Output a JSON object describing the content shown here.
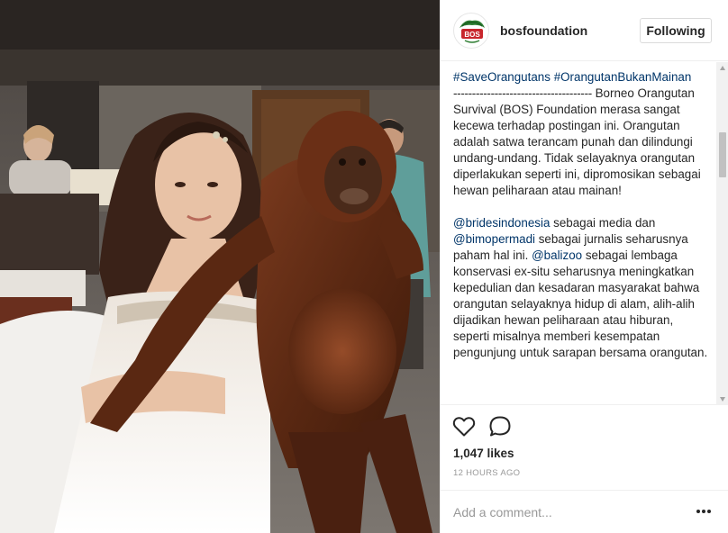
{
  "post": {
    "username": "bosfoundation",
    "follow_label": "Following",
    "logo_text": "BOS",
    "caption": {
      "hashtag1": "#SaveOrangutans",
      "hashtag2": "#OrangutanBukanMainan",
      "dashes": "-------------------------------------",
      "para1": " Borneo Orangutan Survival (BOS) Foundation merasa sangat kecewa terhadap postingan ini. Orangutan adalah satwa terancam punah dan dilindungi undang-undang. Tidak selayaknya orangutan diperlakukan seperti ini, dipromosikan sebagai hewan peliharaan atau mainan!",
      "mention1": "@bridesindonesia",
      "text2": " sebagai media dan ",
      "mention2": "@bimopermadi",
      "text3": " sebagai jurnalis seharusnya paham hal ini. ",
      "mention3": "@balizoo",
      "text4": " sebagai lembaga konservasi ex-situ seharusnya meningkatkan kepedulian dan kesadaran masyarakat bahwa orangutan selayaknya hidup di alam, alih-alih dijadikan hewan peliharaan atau hiburan, seperti misalnya memberi kesempatan pengunjung untuk sarapan bersama orangutan."
    },
    "likes": "1,047 likes",
    "timestamp": "12 HOURS AGO",
    "comment_placeholder": "Add a comment...",
    "icons": {
      "like": "heart-icon",
      "comment": "comment-bubble-icon",
      "more": "more-options-icon"
    }
  },
  "colors": {
    "link": "#003569",
    "text": "#262626",
    "muted": "#999999",
    "logo_red": "#c8262c",
    "logo_green": "#2e7d32"
  }
}
